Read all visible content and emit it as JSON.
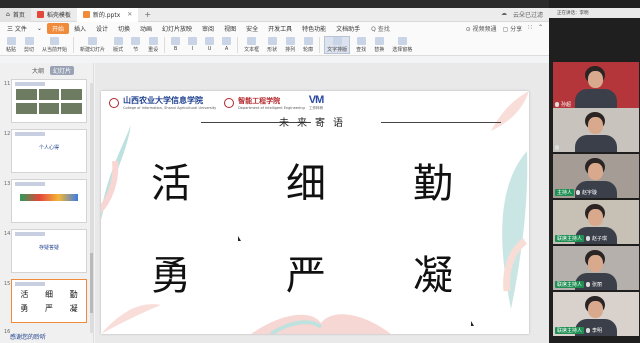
{
  "titlebar": {
    "home_tab": "首页",
    "tabs": [
      {
        "label": "稻壳模板",
        "color": "#e4463b"
      },
      {
        "label": "新的.pptx",
        "color": "#f08b3b"
      }
    ],
    "right_status": "云朵已过滤"
  },
  "menubar": {
    "items": [
      "三 文件",
      "⌄",
      "开始",
      "插入",
      "设计",
      "切换",
      "动画",
      "幻灯片放映",
      "审阅",
      "视图",
      "安全",
      "开发工具",
      "特色功能",
      "文档助手"
    ],
    "start_index": 2,
    "search": "Q 查找",
    "right": [
      "⊙ 视频频通",
      "▢ 分享",
      "∷",
      "⌃"
    ]
  },
  "ribbon": {
    "items": [
      "粘贴",
      "剪切",
      "从当前开始",
      "新建幻灯片",
      "版式",
      "节",
      "重设",
      "B",
      "I",
      "U",
      "A",
      "文本框",
      "形状",
      "排列",
      "轮廓",
      "文字排版",
      "查找",
      "替换",
      "选择窗格"
    ],
    "selected_index": 15
  },
  "leftpane": {
    "tabs": [
      "大纲",
      "幻灯片"
    ],
    "active_tab": 1,
    "slide_numbers": [
      "11",
      "12",
      "13",
      "14",
      "15",
      "16"
    ],
    "thumb_titles": [
      "",
      "个人心得",
      "",
      "存疑答疑",
      "",
      ""
    ],
    "thumb16_glyphs_row1": [
      "活",
      "细",
      "勤"
    ],
    "thumb16_glyphs_row2": [
      "勇",
      "严",
      "凝"
    ],
    "end_label": "感谢您的聆听"
  },
  "slide": {
    "school_name": "山西农业大学信息学院",
    "school_en": "College of Information, Shanxi Agricultural University",
    "dept_name": "智能工程学院",
    "dept_en": "Department of Intelligent Engineering",
    "brand": "VM",
    "brand_sub": "工作科研",
    "title": "未来寄语",
    "glyphs": [
      "活",
      "细",
      "勤",
      "勇",
      "严",
      "凝"
    ]
  },
  "meeting": {
    "top_label": "正在讲话：李明",
    "participants": [
      {
        "name": "孙超",
        "host": "",
        "bg": "#b5363a"
      },
      {
        "name": "",
        "host": "",
        "bg": "#c9c3bd"
      },
      {
        "name": "赵宇璇",
        "host": "主持人",
        "bg": "#a49c95"
      },
      {
        "name": "赵子琪",
        "host": "联席主持人",
        "bg": "#c7c0b5"
      },
      {
        "name": "张丽",
        "host": "联席主持人",
        "bg": "#b5b0ab"
      },
      {
        "name": "李明",
        "host": "联席主持人",
        "bg": "#d8d1cc"
      }
    ]
  }
}
